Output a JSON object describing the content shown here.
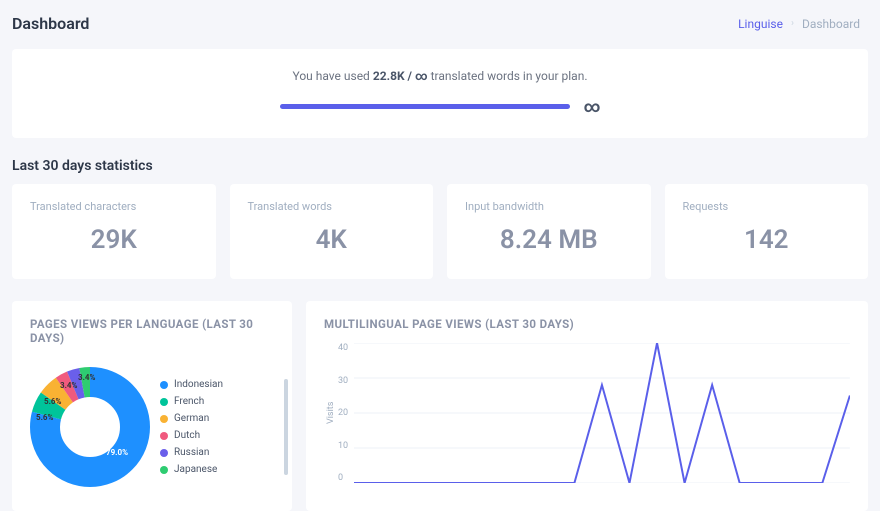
{
  "header": {
    "title": "Dashboard",
    "breadcrumb_link": "Linguise",
    "breadcrumb_current": "Dashboard"
  },
  "usage": {
    "prefix": "You have used ",
    "bold": "22.8K / ∞",
    "suffix": " translated words in your plan.",
    "infinity": "∞"
  },
  "section_title": "Last 30 days statistics",
  "stats": [
    {
      "label": "Translated characters",
      "value": "29K"
    },
    {
      "label": "Translated words",
      "value": "4K"
    },
    {
      "label": "Input bandwidth",
      "value": "8.24 MB"
    },
    {
      "label": "Requests",
      "value": "142"
    }
  ],
  "charts": {
    "donut_title": "PAGES VIEWS PER LANGUAGE (LAST 30 DAYS)",
    "line_title": "MULTILINGUAL PAGE VIEWS (LAST 30 DAYS)",
    "yaxis": "Visits"
  },
  "chart_data": [
    {
      "type": "pie",
      "title": "PAGES VIEWS PER LANGUAGE (LAST 30 DAYS)",
      "slices": [
        {
          "label": "Indonesian",
          "value": 79.0,
          "color": "#1e90ff"
        },
        {
          "label": "French",
          "value": 5.6,
          "color": "#00c49a"
        },
        {
          "label": "German",
          "value": 5.6,
          "color": "#f9b233"
        },
        {
          "label": "Dutch",
          "value": 3.4,
          "color": "#f05a7e"
        },
        {
          "label": "Russian",
          "value": 3.4,
          "color": "#6a5fea"
        },
        {
          "label": "Japanese",
          "value": 3.0,
          "color": "#2ecc71"
        }
      ],
      "labels_shown": [
        "79.0%",
        "5.6%",
        "5.6%",
        "3.4%",
        "3.4%"
      ]
    },
    {
      "type": "line",
      "title": "MULTILINGUAL PAGE VIEWS (LAST 30 DAYS)",
      "ylabel": "Visits",
      "ylim": [
        0,
        40
      ],
      "yticks": [
        0,
        10,
        20,
        30,
        40
      ],
      "x": [
        0,
        1,
        2,
        3,
        4,
        5,
        6,
        7,
        8,
        9,
        10,
        11,
        12,
        13,
        14,
        15,
        16,
        17,
        18
      ],
      "values": [
        0,
        0,
        0,
        0,
        0,
        0,
        0,
        0,
        0,
        28,
        0,
        40,
        0,
        28,
        0,
        0,
        0,
        0,
        25
      ]
    }
  ]
}
